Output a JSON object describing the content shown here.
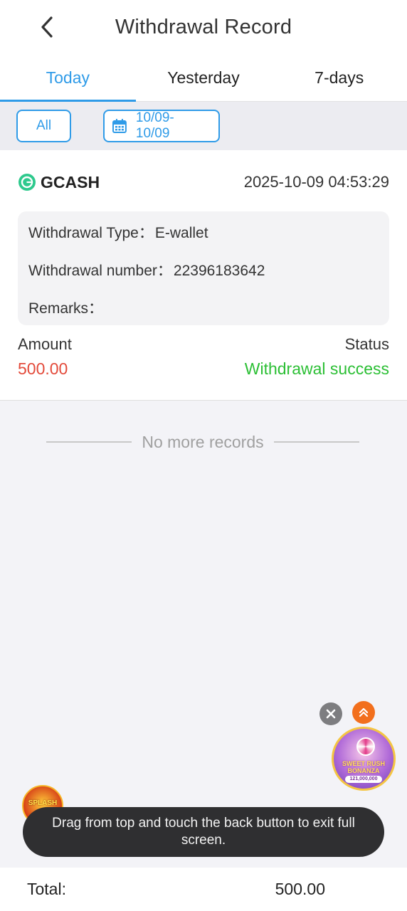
{
  "header": {
    "title": "Withdrawal Record",
    "back_icon": "chevron-left-icon"
  },
  "tabs": [
    {
      "label": "Today",
      "active": true
    },
    {
      "label": "Yesterday",
      "active": false
    },
    {
      "label": "7-days",
      "active": false
    }
  ],
  "filters": {
    "all_label": "All",
    "date_range": "10/09- 10/09",
    "date_icon": "calendar-icon"
  },
  "record": {
    "method": "GCASH",
    "method_icon": "gcash-logo-icon",
    "timestamp": "2025-10-09 04:53:29",
    "type_label": "Withdrawal Type：",
    "type_value": "E-wallet",
    "number_label": "Withdrawal number：",
    "number_value": "22396183642",
    "remarks_label": "Remarks：",
    "remarks_value": "",
    "amount_label": "Amount",
    "amount_value": "500.00",
    "status_label": "Status",
    "status_value": "Withdrawal success"
  },
  "list_end": {
    "text": "No more records"
  },
  "floating": {
    "promo_title": "SWEET RUSH BONANZA",
    "promo_amount": "121,000,000",
    "left_game_text": "SPLASH"
  },
  "toast": {
    "text": "Drag from top and touch the back button to exit full screen."
  },
  "footer": {
    "total_label": "Total:",
    "total_value": "500.00"
  },
  "colors": {
    "accent": "#2f9be8",
    "amount": "#e34a3a",
    "success": "#2bbf34"
  }
}
